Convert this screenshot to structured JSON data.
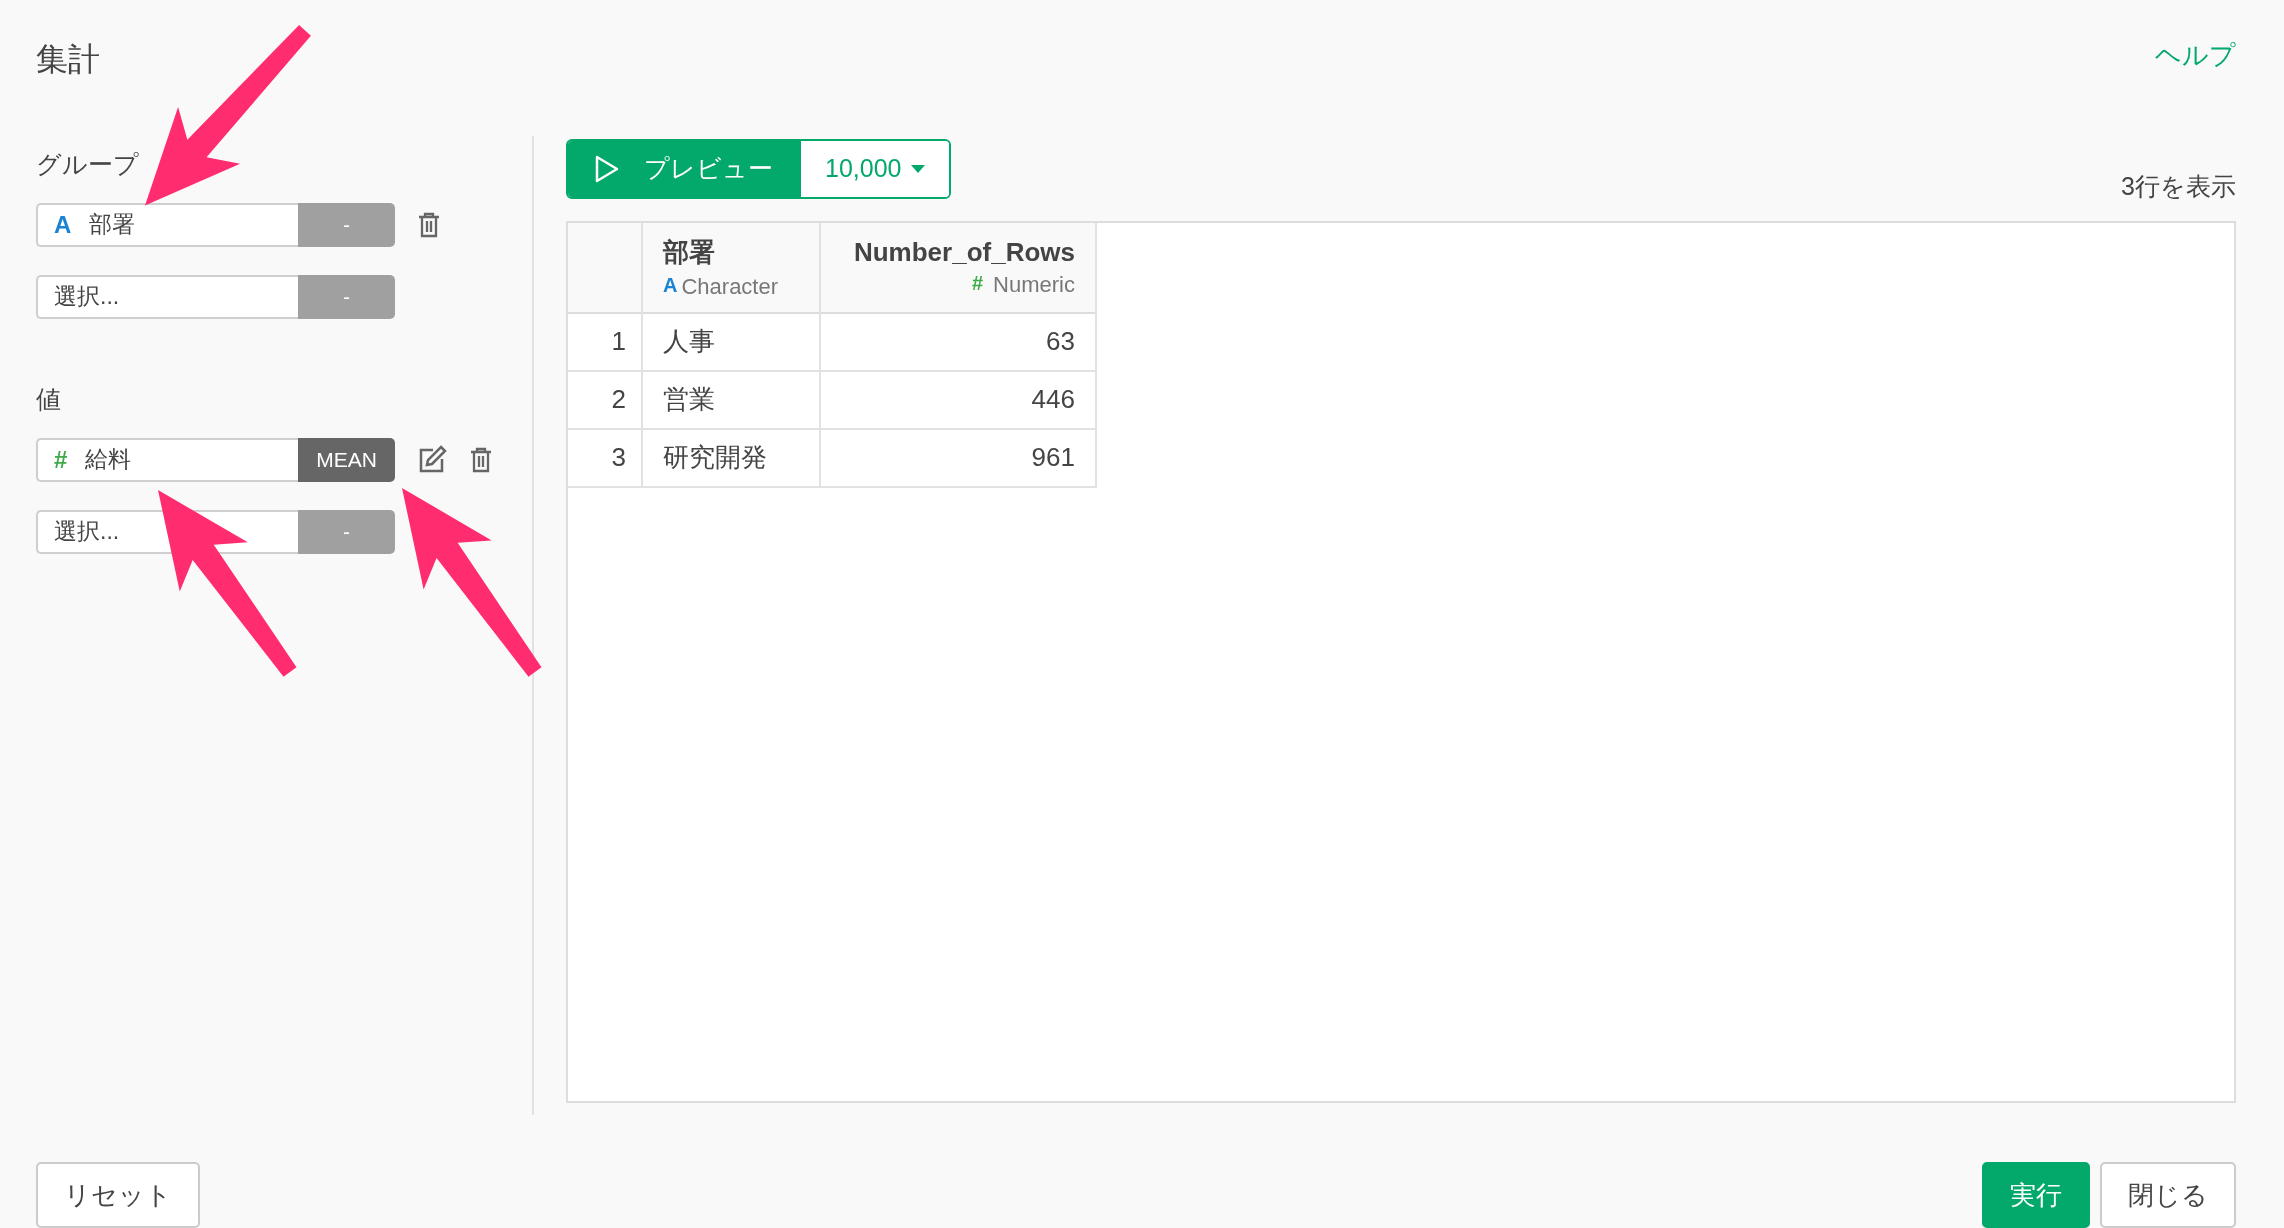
{
  "title": "集計",
  "help_link": "ヘルプ",
  "group": {
    "label": "グループ",
    "items": [
      {
        "kind": "column",
        "color": "#1a84d4",
        "type_icon": "A",
        "name": "部署",
        "function": "-",
        "function_set": false,
        "removable": true
      },
      {
        "kind": "select",
        "placeholder": "選択...",
        "function": "-",
        "function_set": false
      }
    ]
  },
  "values": {
    "label": "値",
    "items": [
      {
        "kind": "column",
        "color": "#3eaa4a",
        "type_icon": "#",
        "name": "給料",
        "function": "MEAN",
        "function_set": true,
        "editable": true,
        "removable": true
      },
      {
        "kind": "select",
        "placeholder": "選択...",
        "function": "-",
        "function_set": false
      }
    ]
  },
  "preview": {
    "button": "プレビュー",
    "rows_limit": "10,000",
    "row_count_label": "3行を表示"
  },
  "table": {
    "columns": [
      {
        "name": "部署",
        "kind": "character",
        "color": "#1a84d4",
        "type_icon": "A",
        "type_label": "Character"
      },
      {
        "name": "Number_of_Rows",
        "kind": "numeric",
        "color": "#3eaa4a",
        "type_icon": "#",
        "type_label": "Numeric"
      }
    ],
    "rows": [
      {
        "index": "1",
        "cells": [
          "人事",
          "63"
        ]
      },
      {
        "index": "2",
        "cells": [
          "営業",
          "446"
        ]
      },
      {
        "index": "3",
        "cells": [
          "研究開発",
          "961"
        ]
      }
    ]
  },
  "buttons": {
    "reset": "リセット",
    "run": "実行",
    "close": "閉じる"
  }
}
